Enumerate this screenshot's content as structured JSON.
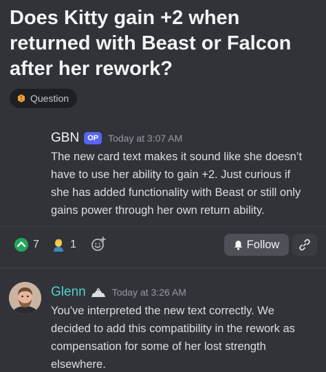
{
  "thread": {
    "title": "Does Kitty gain +2 when returned with Beast or Falcon after her rework?",
    "tag": {
      "label": "Question",
      "icon": "question-tag-icon",
      "color": "#f0a232"
    }
  },
  "messages": [
    {
      "author": "GBN",
      "badge": "OP",
      "timestamp": "Today at 3:07 AM",
      "lines": [
        "The new card text makes it sound like she doesn’t",
        "have to use her ability to gain +2. Just curious if",
        "she has added functionality with Beast or still only",
        "gains power through her own return ability."
      ]
    },
    {
      "author": "Glenn",
      "author_color": "#4fd4c9",
      "timestamp": "Today at 3:26 AM",
      "lines": [
        "You've interpreted the new text correctly. We",
        "decided to add this compatibility in the rework as",
        "compensation for some of her lost strength",
        "elsewhere."
      ]
    }
  ],
  "reactions": [
    {
      "icon": "upvote-icon",
      "count": "7"
    },
    {
      "icon": "person-emoji-icon",
      "count": "1"
    }
  ],
  "actions": {
    "follow_label": "Follow",
    "accent_follow": "#4e5058"
  }
}
